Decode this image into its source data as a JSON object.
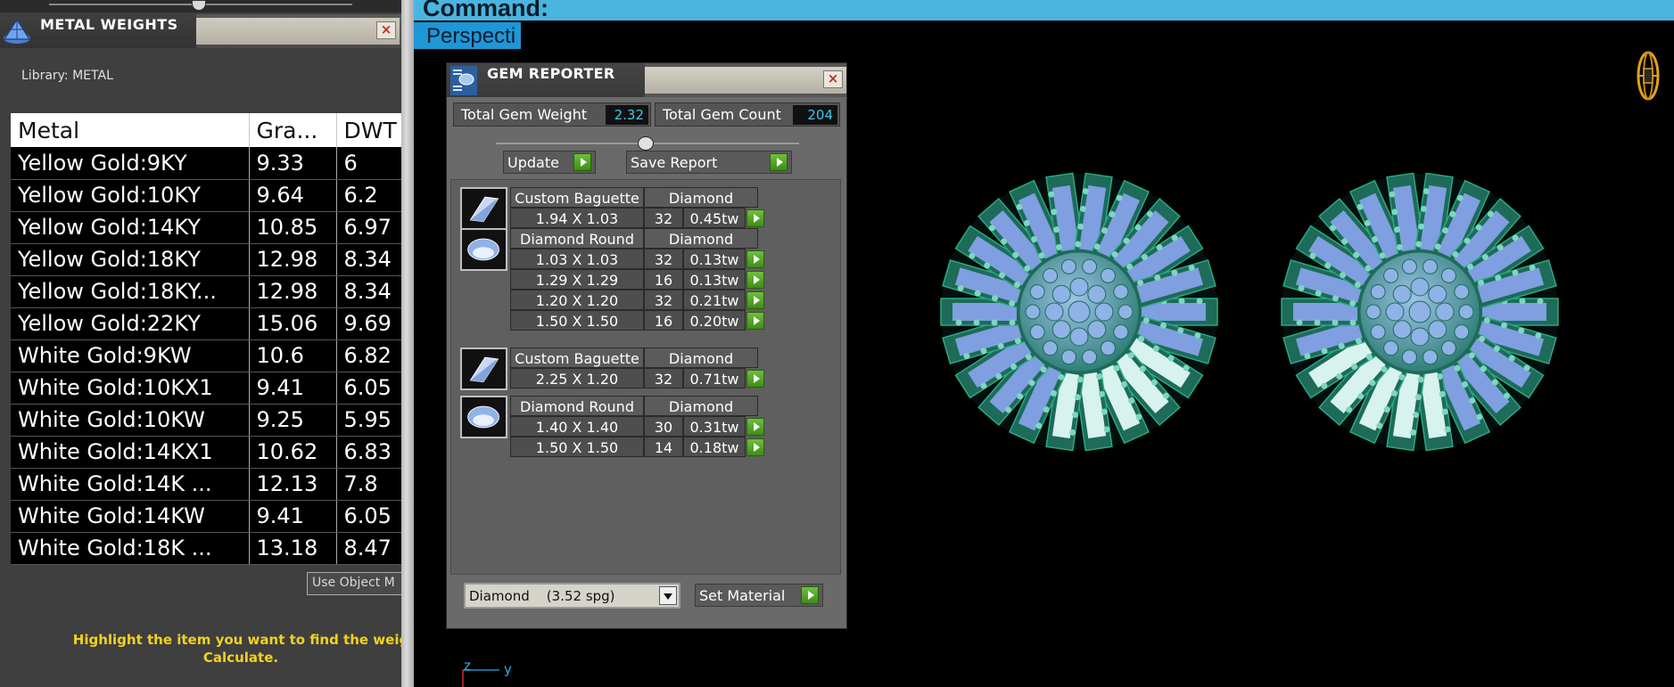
{
  "metal_weights": {
    "title": "METAL WEIGHTS",
    "close_glyph": "×",
    "library_label": "Library: METAL",
    "columns": [
      "Metal",
      "Gra...",
      "DWT"
    ],
    "rows": [
      [
        "Yellow Gold:9KY",
        "9.33",
        "6"
      ],
      [
        "Yellow Gold:10KY",
        "9.64",
        "6.2"
      ],
      [
        "Yellow Gold:14KY",
        "10.85",
        "6.97"
      ],
      [
        "Yellow Gold:18KY",
        "12.98",
        "8.34"
      ],
      [
        "Yellow Gold:18KY...",
        "12.98",
        "8.34"
      ],
      [
        "Yellow Gold:22KY",
        "15.06",
        "9.69"
      ],
      [
        "White Gold:9KW",
        "10.6",
        "6.82"
      ],
      [
        "White Gold:10KX1",
        "9.41",
        "6.05"
      ],
      [
        "White Gold:10KW",
        "9.25",
        "5.95"
      ],
      [
        "White Gold:14KX1",
        "10.62",
        "6.83"
      ],
      [
        "White Gold:14K ...",
        "12.13",
        "7.8"
      ],
      [
        "White Gold:14KW",
        "9.41",
        "6.05"
      ],
      [
        "White Gold:18K ...",
        "13.18",
        "8.47"
      ]
    ],
    "use_object_button": "Use Object M",
    "hint_line1": "Highlight the item you want to find the weig",
    "hint_line2": "Calculate."
  },
  "command_bar": {
    "label": "Command:"
  },
  "viewport": {
    "label": "Perspecti"
  },
  "gem_reporter": {
    "title": "GEM REPORTER",
    "close_glyph": "×",
    "total_weight_label": "Total Gem Weight",
    "total_weight_value": "2.32",
    "total_count_label": "Total Gem Count",
    "total_count_value": "204",
    "update_button": "Update",
    "save_report_button": "Save Report",
    "groups": [
      {
        "thumb": "baguette-icon",
        "cut": "Custom Baguette",
        "material": "Diamond",
        "rows": [
          {
            "size": "1.94 X 1.03",
            "count": "32",
            "weight": "0.45tw"
          }
        ]
      },
      {
        "thumb": "round-icon",
        "cut": "Diamond Round",
        "material": "Diamond",
        "rows": [
          {
            "size": "1.03 X 1.03",
            "count": "32",
            "weight": "0.13tw"
          },
          {
            "size": "1.29 X 1.29",
            "count": "16",
            "weight": "0.13tw"
          },
          {
            "size": "1.20 X 1.20",
            "count": "32",
            "weight": "0.21tw"
          },
          {
            "size": "1.50 X 1.50",
            "count": "16",
            "weight": "0.20tw"
          }
        ]
      },
      {
        "thumb": "baguette-icon",
        "cut": "Custom Baguette",
        "material": "Diamond",
        "rows": [
          {
            "size": "2.25 X 1.20",
            "count": "32",
            "weight": "0.71tw"
          }
        ]
      },
      {
        "thumb": "round-icon",
        "cut": "Diamond Round",
        "material": "Diamond",
        "rows": [
          {
            "size": "1.40 X 1.40",
            "count": "30",
            "weight": "0.31tw"
          },
          {
            "size": "1.50 X 1.50",
            "count": "14",
            "weight": "0.18tw"
          }
        ]
      }
    ],
    "material_select_value": "Diamond    (3.52 spg)",
    "set_material_button": "Set Material"
  },
  "axis": {
    "z": "z",
    "y": "y"
  },
  "colors": {
    "accent_blue": "#4ab5e0",
    "go_green": "#4fa321",
    "highlight_yellow": "#f2d21b",
    "value_cyan": "#3ec8f0"
  }
}
